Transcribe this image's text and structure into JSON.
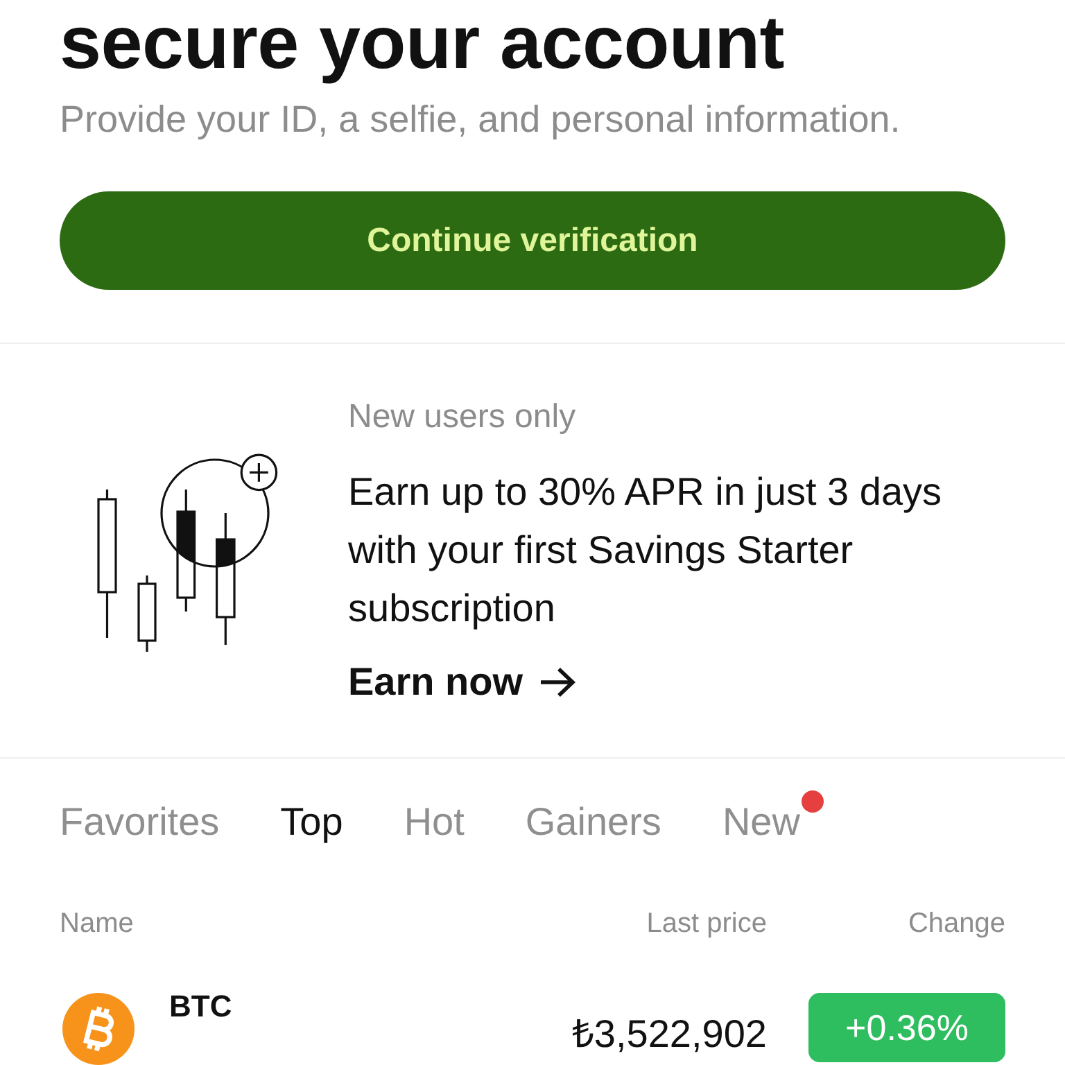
{
  "verification": {
    "title": "secure your account",
    "subtitle": "Provide your ID, a selfie, and personal information.",
    "button": "Continue verification"
  },
  "promo": {
    "eyebrow": "New users only",
    "headline": "Earn up to 30% APR in just 3 days with your first Savings Starter subscription",
    "link": "Earn now"
  },
  "market_tabs": [
    {
      "label": "Favorites",
      "selected": false,
      "unread": false
    },
    {
      "label": "Top",
      "selected": true,
      "unread": false
    },
    {
      "label": "Hot",
      "selected": false,
      "unread": false
    },
    {
      "label": "Gainers",
      "selected": false,
      "unread": false
    },
    {
      "label": "New",
      "selected": false,
      "unread": true
    }
  ],
  "table": {
    "columns": [
      "Name",
      "Last price",
      "Change"
    ],
    "rows": [
      {
        "symbol": "BTC",
        "price": "₺3,522,902",
        "change": "+0.36%",
        "color": "#2ebd5f"
      }
    ]
  }
}
